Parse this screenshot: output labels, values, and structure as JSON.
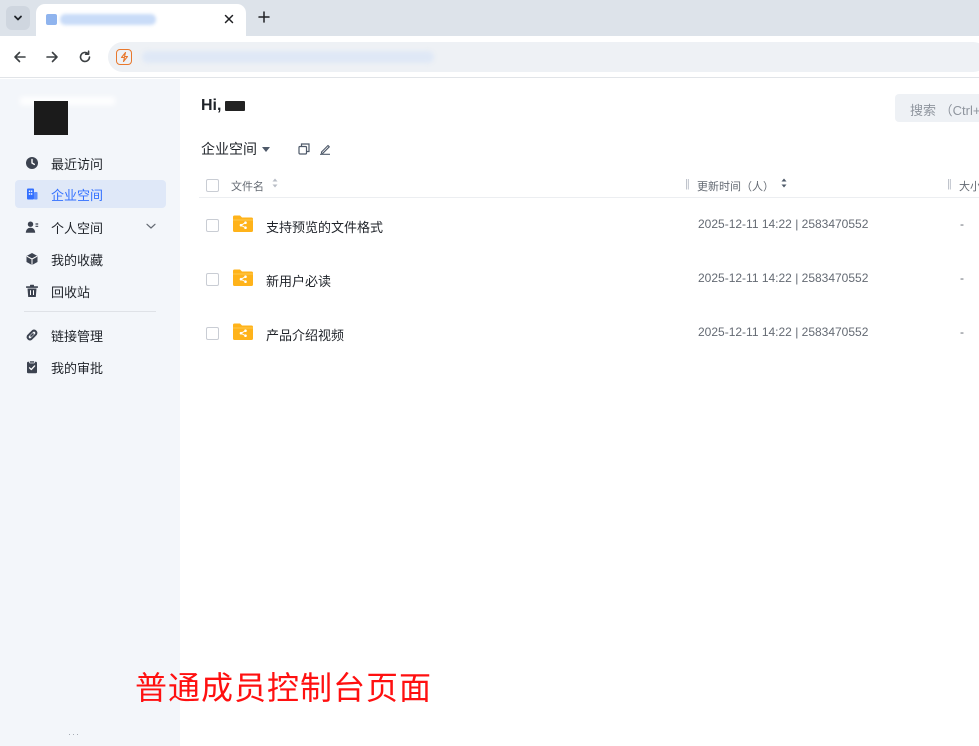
{
  "browser": {
    "tab_title": "",
    "url": "",
    "icons": {
      "tab_menu": "chevron-down-icon",
      "close": "close-icon",
      "new_tab": "plus-icon",
      "back": "arrow-left-icon",
      "forward": "arrow-right-icon",
      "reload": "reload-icon",
      "site": "lightning-icon"
    }
  },
  "sidebar": {
    "items": [
      {
        "label": "最近访问",
        "icon": "clock-icon",
        "active": false
      },
      {
        "label": "企业空间",
        "icon": "building-icon",
        "active": true
      },
      {
        "label": "个人空间",
        "icon": "user-icon",
        "active": false,
        "expandable": true
      },
      {
        "label": "我的收藏",
        "icon": "cube-icon",
        "active": false
      },
      {
        "label": "回收站",
        "icon": "trash-icon",
        "active": false
      },
      {
        "label": "链接管理",
        "icon": "link-icon",
        "active": false
      },
      {
        "label": "我的审批",
        "icon": "clipboard-check-icon",
        "active": false
      }
    ],
    "footer": "···"
  },
  "main": {
    "greeting": "Hi,",
    "search_placeholder": "搜索 （Ctrl+",
    "space_select": "企业空间",
    "columns": {
      "name": "文件名",
      "updated": "更新时间（人）",
      "size": "大小"
    },
    "files": [
      {
        "name": "支持预览的文件格式",
        "updated": "2025-12-11 14:22 | 2583470552",
        "size": "-"
      },
      {
        "name": "新用户必读",
        "updated": "2025-12-11 14:22 | 2583470552",
        "size": "-"
      },
      {
        "name": "产品介绍视频",
        "updated": "2025-12-11 14:22 | 2583470552",
        "size": "-"
      }
    ]
  },
  "caption": "普通成员控制台页面",
  "colors": {
    "accent": "#3370ff",
    "sidebar_bg": "#f3f6fa",
    "active_bg": "#dfe8f8",
    "folder": "#ffb31a",
    "caption": "#ff1010"
  }
}
